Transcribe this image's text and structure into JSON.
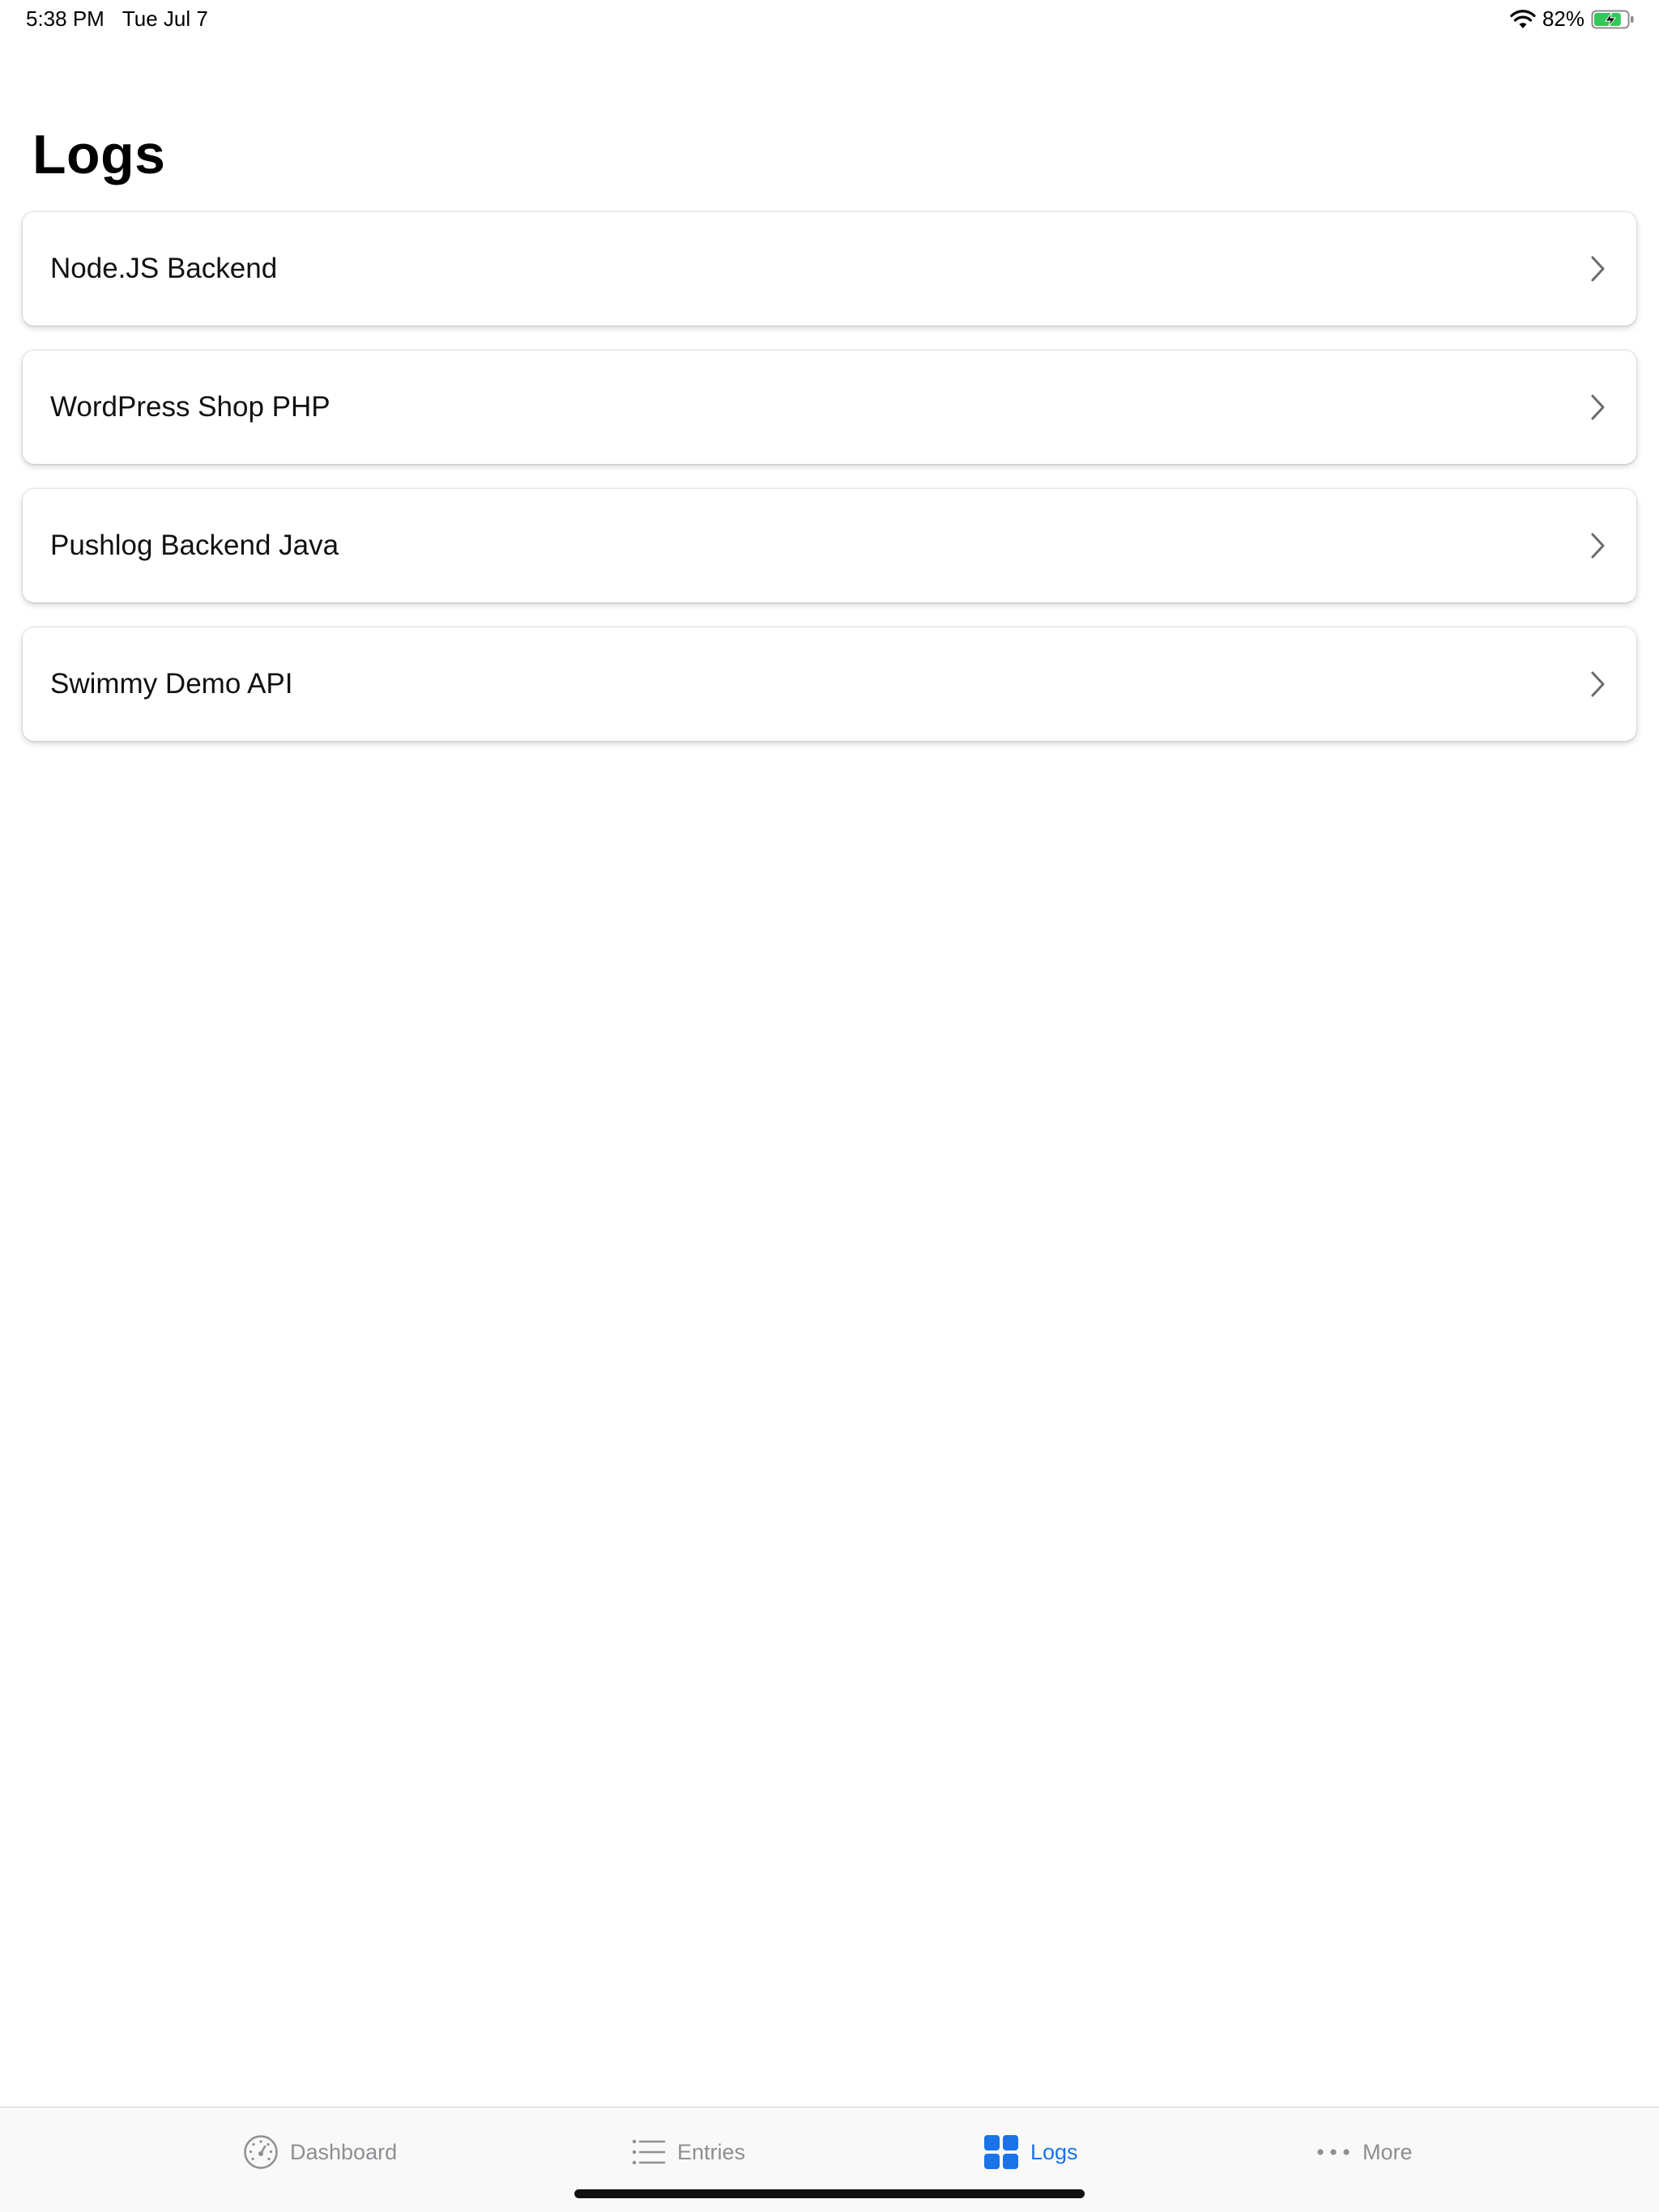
{
  "status_bar": {
    "time": "5:38 PM",
    "date": "Tue Jul 7",
    "battery_percent": "82%",
    "battery_level": 0.82
  },
  "page": {
    "title": "Logs"
  },
  "logs": [
    {
      "label": "Node.JS Backend"
    },
    {
      "label": "WordPress Shop PHP"
    },
    {
      "label": "Pushlog Backend Java"
    },
    {
      "label": "Swimmy Demo API"
    }
  ],
  "tab_bar": {
    "tabs": [
      {
        "label": "Dashboard",
        "icon": "speedometer-icon",
        "active": false
      },
      {
        "label": "Entries",
        "icon": "list-icon",
        "active": false
      },
      {
        "label": "Logs",
        "icon": "grid-icon",
        "active": true
      },
      {
        "label": "More",
        "icon": "ellipsis-icon",
        "active": false
      }
    ]
  },
  "colors": {
    "accent": "#1a73e8",
    "inactive": "#8e8e93",
    "battery_fill": "#34c759"
  }
}
